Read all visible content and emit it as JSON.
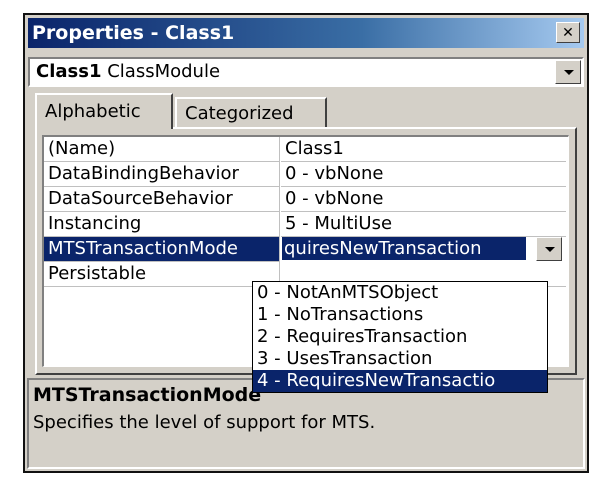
{
  "window": {
    "title": "Properties - Class1",
    "close_glyph": "✕"
  },
  "object_selector": {
    "name": "Class1",
    "type": "ClassModule"
  },
  "tabs": [
    {
      "label": "Alphabetic",
      "active": true
    },
    {
      "label": "Categorized",
      "active": false
    }
  ],
  "properties": [
    {
      "name": "(Name)",
      "value": "Class1"
    },
    {
      "name": "DataBindingBehavior",
      "value": "0 - vbNone"
    },
    {
      "name": "DataSourceBehavior",
      "value": "0 - vbNone"
    },
    {
      "name": "Instancing",
      "value": "5 - MultiUse"
    },
    {
      "name": "MTSTransactionMode",
      "value": "quiresNewTransaction",
      "selected": true
    },
    {
      "name": "Persistable",
      "value": ""
    }
  ],
  "dropdown": {
    "options": [
      "0 - NotAnMTSObject",
      "1 - NoTransactions",
      "2 - RequiresTransaction",
      "3 - UsesTransaction",
      "4 - RequiresNewTransactio"
    ],
    "selected_index": 4
  },
  "description": {
    "title": "MTSTransactionMode",
    "text": "Specifies the level of support for MTS."
  },
  "colors": {
    "selection": "#0a246a",
    "face": "#d4d0c8",
    "title_gradient_start": "#0a246a"
  }
}
